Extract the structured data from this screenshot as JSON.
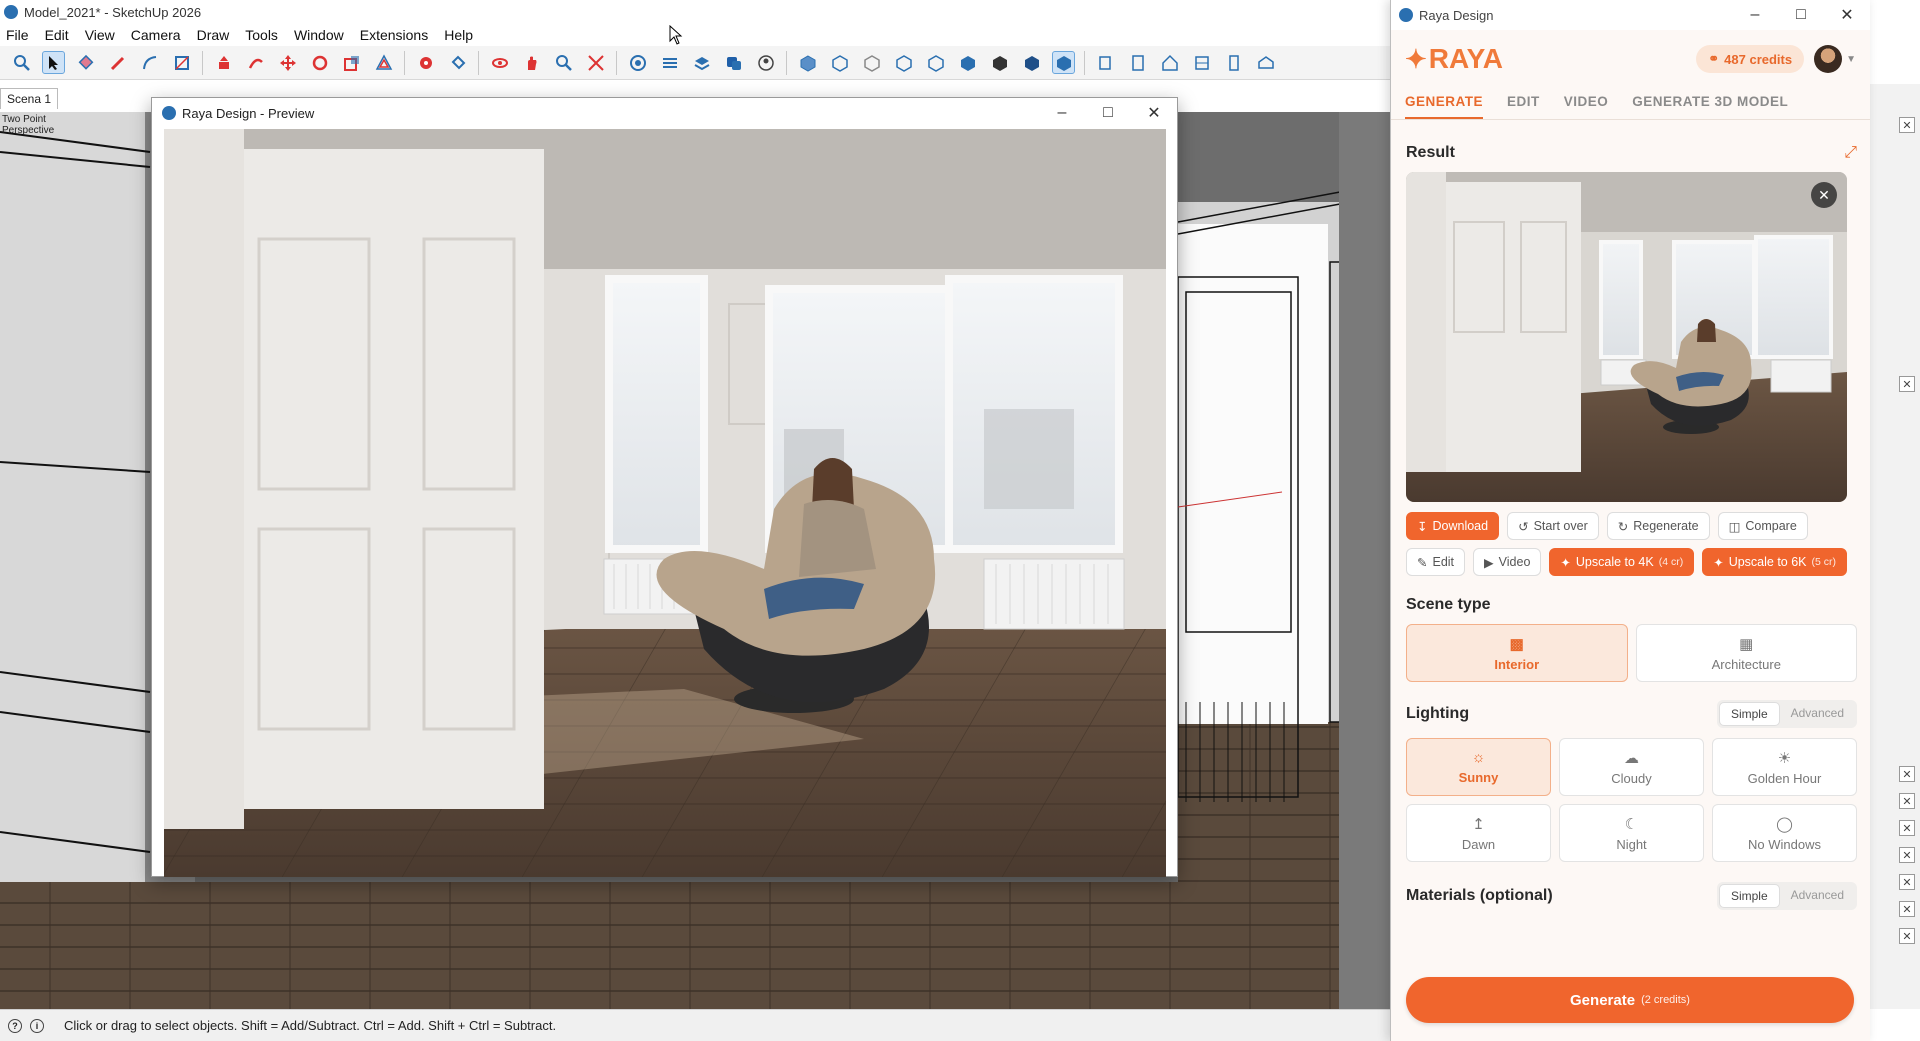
{
  "sketchup": {
    "title": "Model_2021* - SketchUp 2026",
    "menu": [
      "File",
      "Edit",
      "View",
      "Camera",
      "Draw",
      "Tools",
      "Window",
      "Extensions",
      "Help"
    ],
    "scene_tab": "Scena 1",
    "perspective_label": "Two Point Perspective",
    "status_text": "Click or drag to select objects. Shift = Add/Subtract. Ctrl = Add. Shift + Ctrl = Subtract."
  },
  "preview": {
    "title": "Raya Design - Preview"
  },
  "raya": {
    "window_title": "Raya Design",
    "logo": "RAYA",
    "credits": "487 credits",
    "tabs": [
      "GENERATE",
      "EDIT",
      "VIDEO",
      "GENERATE 3D MODEL"
    ],
    "result_title": "Result",
    "actions": {
      "download": "Download",
      "start_over": "Start over",
      "regenerate": "Regenerate",
      "compare": "Compare",
      "edit": "Edit",
      "video": "Video",
      "upscale_4k": "Upscale to 4K",
      "upscale_4k_cost": "(4 cr)",
      "upscale_6k": "Upscale to 6K",
      "upscale_6k_cost": "(5 cr)"
    },
    "scene_type": {
      "title": "Scene type",
      "options": [
        "Interior",
        "Architecture"
      ]
    },
    "lighting": {
      "title": "Lighting",
      "mode_simple": "Simple",
      "mode_advanced": "Advanced",
      "options": [
        "Sunny",
        "Cloudy",
        "Golden Hour",
        "Dawn",
        "Night",
        "No Windows"
      ]
    },
    "materials": {
      "title": "Materials (optional)",
      "mode_simple": "Simple",
      "mode_advanced": "Advanced"
    },
    "generate": {
      "label": "Generate",
      "cost": "(2 credits)"
    }
  },
  "colors": {
    "accent": "#f0652d",
    "accent_light": "#fbe8dc",
    "panel_bg": "#fdf8f5"
  }
}
